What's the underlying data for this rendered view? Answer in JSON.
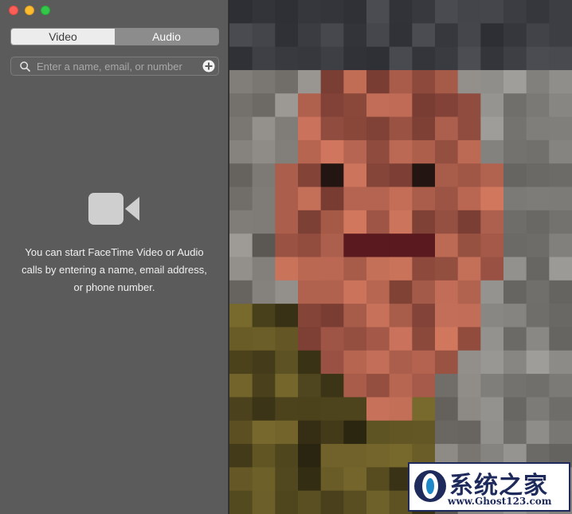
{
  "segments": {
    "video_label": "Video",
    "audio_label": "Audio",
    "selected": "Audio"
  },
  "search": {
    "placeholder": "Enter a name, email, or number"
  },
  "empty_state": {
    "icon": "video-camera-icon",
    "message": "You can start FaceTime Video or Audio calls by entering a name, email address, or phone number."
  },
  "watermark": {
    "title": "系统之家",
    "url": "www.Ghost123.com"
  },
  "colors": {
    "sidebar": "#5b5b5b",
    "segment_active": "#8c8c8c",
    "segment_inactive": "#ececec",
    "close": "#fc5f57",
    "minimize": "#fdbc2e",
    "maximize": "#34c84a"
  }
}
